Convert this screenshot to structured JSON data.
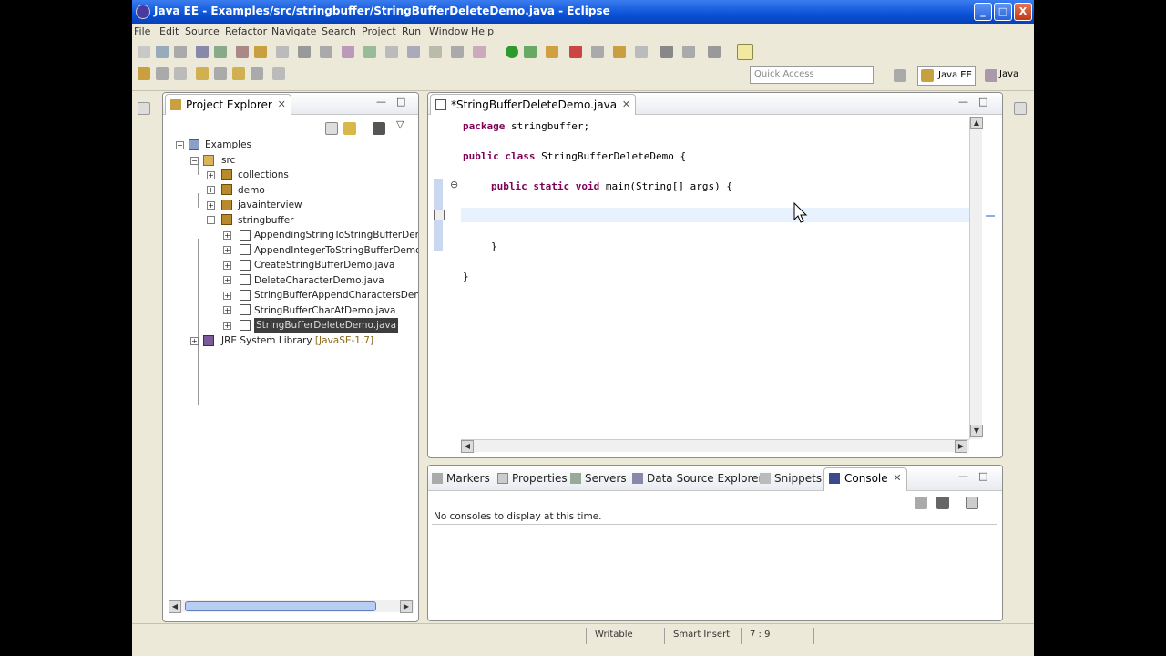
{
  "window": {
    "title": "Java EE - Examples/src/stringbuffer/StringBufferDeleteDemo.java - Eclipse",
    "min_label": "_",
    "max_label": "□",
    "close_label": "X"
  },
  "menu": {
    "items": [
      "File",
      "Edit",
      "Source",
      "Refactor",
      "Navigate",
      "Search",
      "Project",
      "Run",
      "Window",
      "Help"
    ]
  },
  "toolbar": {
    "quick_access_placeholder": "Quick Access",
    "perspective_java_ee": "Java EE",
    "perspective_java": "Java"
  },
  "project_explorer": {
    "tab_label": "Project Explorer",
    "close_label": "✕",
    "min_label": "—",
    "max_label": "□",
    "menu_label": "▽",
    "tree": {
      "root": "Examples",
      "src": "src",
      "packages": [
        "collections",
        "demo",
        "javainterview",
        "stringbuffer"
      ],
      "files": [
        "AppendingStringToStringBufferDemo",
        "AppendIntegerToStringBufferDemo.j",
        "CreateStringBufferDemo.java",
        "DeleteCharacterDemo.java",
        "StringBufferAppendCharactersDemo",
        "StringBufferCharAtDemo.java",
        "StringBufferDeleteDemo.java"
      ],
      "library": "JRE System Library",
      "library_version": "[JavaSE-1.7]"
    }
  },
  "editor": {
    "tab_label": "*StringBufferDeleteDemo.java",
    "close_label": "✕",
    "min_label": "—",
    "max_label": "□",
    "code": {
      "line1_kw": "package",
      "line1_rest": " stringbuffer;",
      "line2_kw1": "public",
      "line2_kw2": "class",
      "line2_rest": " StringBufferDeleteDemo {",
      "line3_kw1": "public",
      "line3_kw2": "static",
      "line3_kw3": "void",
      "line3_rest": " main(String[] args) {",
      "line4": "}",
      "line5": "}"
    },
    "fold_marker": "⊖"
  },
  "bottom_panel": {
    "tabs": [
      "Markers",
      "Properties",
      "Servers",
      "Data Source Explorer",
      "Snippets",
      "Console"
    ],
    "active_tab": "Console",
    "close_label": "✕",
    "min_label": "—",
    "max_label": "□",
    "message": "No consoles to display at this time."
  },
  "status": {
    "writable": "Writable",
    "insert_mode": "Smart Insert",
    "position": "7 : 9"
  },
  "colors": {
    "keyword": "#7f0055",
    "title_bar": "#0a52d8",
    "chrome": "#ece9d8"
  }
}
